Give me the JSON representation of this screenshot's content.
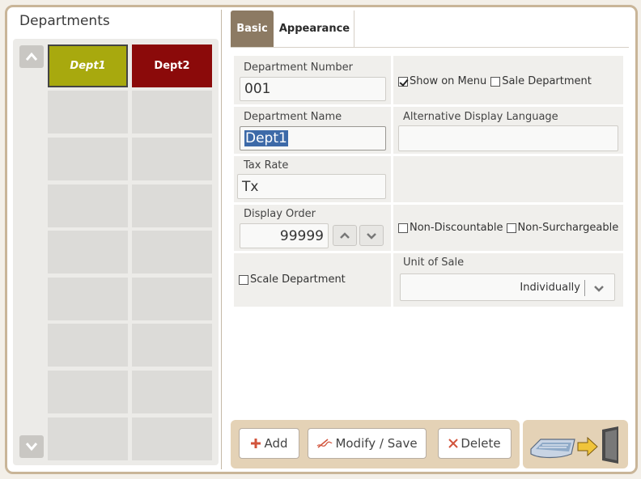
{
  "left_panel": {
    "title": "Departments",
    "departments": [
      "Dept1",
      "Dept2"
    ]
  },
  "tabs": [
    {
      "label": "Basic",
      "active": true
    },
    {
      "label": "Appearance",
      "active": false
    }
  ],
  "form": {
    "department_number": {
      "label": "Department Number",
      "value": "001"
    },
    "show_on_menu": {
      "label": "Show on Menu",
      "checked": true
    },
    "sale_department": {
      "label": "Sale Department",
      "checked": false
    },
    "department_name": {
      "label": "Department Name",
      "value": "Dept1"
    },
    "alt_display_language": {
      "label": "Alternative Display Language",
      "value": ""
    },
    "tax_rate": {
      "label": "Tax Rate",
      "value": "Tx"
    },
    "display_order": {
      "label": "Display Order",
      "value": "99999"
    },
    "non_discountable": {
      "label": "Non-Discountable",
      "checked": false
    },
    "non_surchargeable": {
      "label": "Non-Surchargeable",
      "checked": false
    },
    "scale_department": {
      "label": "Scale Department",
      "checked": false
    },
    "unit_of_sale": {
      "label": "Unit of Sale",
      "value": "Individually"
    }
  },
  "actions": {
    "add": "Add",
    "modify_save": "Modify / Save",
    "delete": "Delete"
  },
  "colors": {
    "dept1": "#a8a90e",
    "dept2": "#8b0a0a",
    "active_tab": "#8c7a63",
    "action_bar": "#e4d2b6"
  }
}
